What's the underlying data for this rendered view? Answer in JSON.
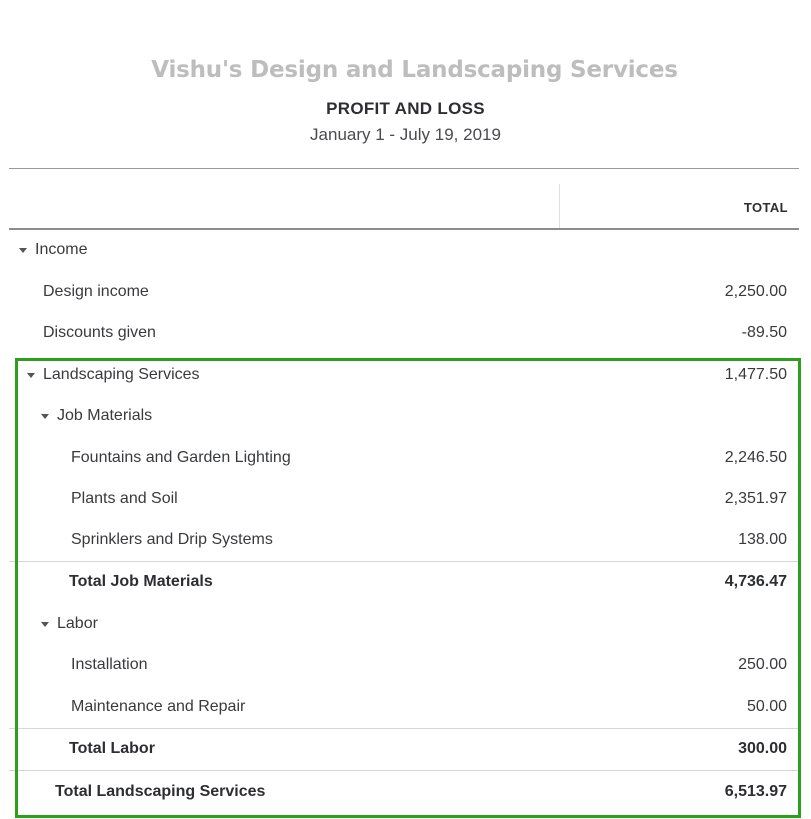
{
  "header": {
    "company_name": "Vishu's Design and Landscaping Services",
    "report_title": "PROFIT AND LOSS",
    "date_range": "January 1 - July 19, 2019"
  },
  "table": {
    "column_header": "TOTAL",
    "rows": {
      "income": {
        "label": "Income",
        "amount": ""
      },
      "design_income": {
        "label": "Design income",
        "amount": "2,250.00"
      },
      "discounts_given": {
        "label": "Discounts given",
        "amount": "-89.50"
      },
      "landscaping_services": {
        "label": "Landscaping Services",
        "amount": "1,477.50"
      },
      "job_materials": {
        "label": "Job Materials",
        "amount": ""
      },
      "fountains": {
        "label": "Fountains and Garden Lighting",
        "amount": "2,246.50"
      },
      "plants_soil": {
        "label": "Plants and Soil",
        "amount": "2,351.97"
      },
      "sprinklers": {
        "label": "Sprinklers and Drip Systems",
        "amount": "138.00"
      },
      "total_job_materials": {
        "label": "Total Job Materials",
        "amount": "4,736.47"
      },
      "labor": {
        "label": "Labor",
        "amount": ""
      },
      "installation": {
        "label": "Installation",
        "amount": "250.00"
      },
      "maintenance": {
        "label": "Maintenance and Repair",
        "amount": "50.00"
      },
      "total_labor": {
        "label": "Total Labor",
        "amount": "300.00"
      },
      "total_landscaping": {
        "label": "Total Landscaping Services",
        "amount": "6,513.97"
      }
    }
  },
  "highlight_color": "#2ca01c"
}
